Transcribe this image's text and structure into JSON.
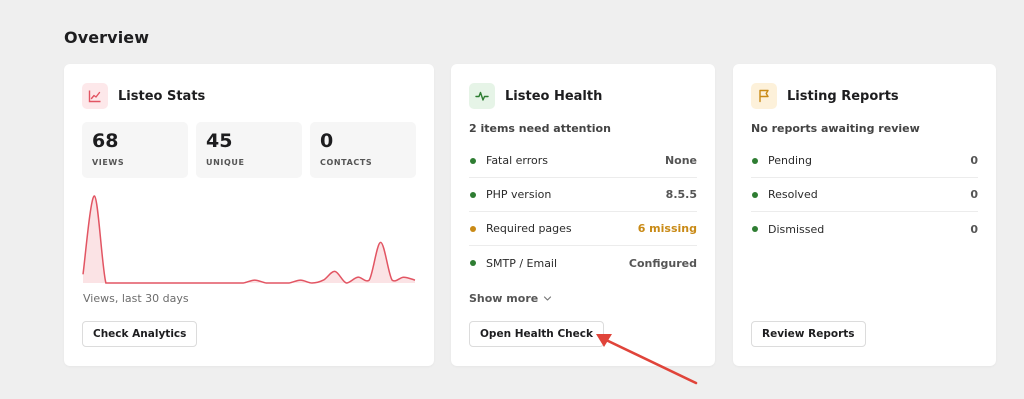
{
  "page": {
    "title": "Overview"
  },
  "stats_card": {
    "title": "Listeo Stats",
    "icon": "line-chart-icon",
    "accent": "#e25563",
    "stats": [
      {
        "value": "68",
        "label": "VIEWS"
      },
      {
        "value": "45",
        "label": "UNIQUE"
      },
      {
        "value": "0",
        "label": "CONTACTS"
      }
    ],
    "caption": "Views, last 30 days",
    "button_label": "Check Analytics"
  },
  "health_card": {
    "title": "Listeo Health",
    "icon": "pulse-icon",
    "subtitle": "2 items need attention",
    "rows": [
      {
        "label": "Fatal errors",
        "value": "None",
        "status": "ok"
      },
      {
        "label": "PHP version",
        "value": "8.5.5",
        "status": "ok"
      },
      {
        "label": "Required pages",
        "value": "6 missing",
        "status": "warn"
      },
      {
        "label": "SMTP / Email",
        "value": "Configured",
        "status": "ok"
      }
    ],
    "show_more_label": "Show more",
    "button_label": "Open Health Check"
  },
  "reports_card": {
    "title": "Listing Reports",
    "icon": "flag-icon",
    "subtitle": "No reports awaiting review",
    "rows": [
      {
        "label": "Pending",
        "value": "0",
        "status": "ok"
      },
      {
        "label": "Resolved",
        "value": "0",
        "status": "ok"
      },
      {
        "label": "Dismissed",
        "value": "0",
        "status": "ok"
      }
    ],
    "button_label": "Review Reports"
  },
  "colors": {
    "ok": "#2e7d32",
    "warn": "#c98a16",
    "annotation_arrow": "#e0443a"
  },
  "chart_data": {
    "type": "area",
    "title": "",
    "xlabel": "",
    "ylabel": "",
    "x": [
      1,
      2,
      3,
      4,
      5,
      6,
      7,
      8,
      9,
      10,
      11,
      12,
      13,
      14,
      15,
      16,
      17,
      18,
      19,
      20,
      21,
      22,
      23,
      24,
      25,
      26,
      27,
      28,
      29,
      30
    ],
    "series": [
      {
        "values": [
          3,
          30,
          0,
          0,
          0,
          0,
          0,
          0,
          0,
          0,
          0,
          0,
          0,
          0,
          0,
          1,
          0,
          0,
          0,
          1,
          0,
          1,
          4,
          0,
          2,
          1,
          14,
          1,
          2,
          1
        ]
      }
    ]
  }
}
